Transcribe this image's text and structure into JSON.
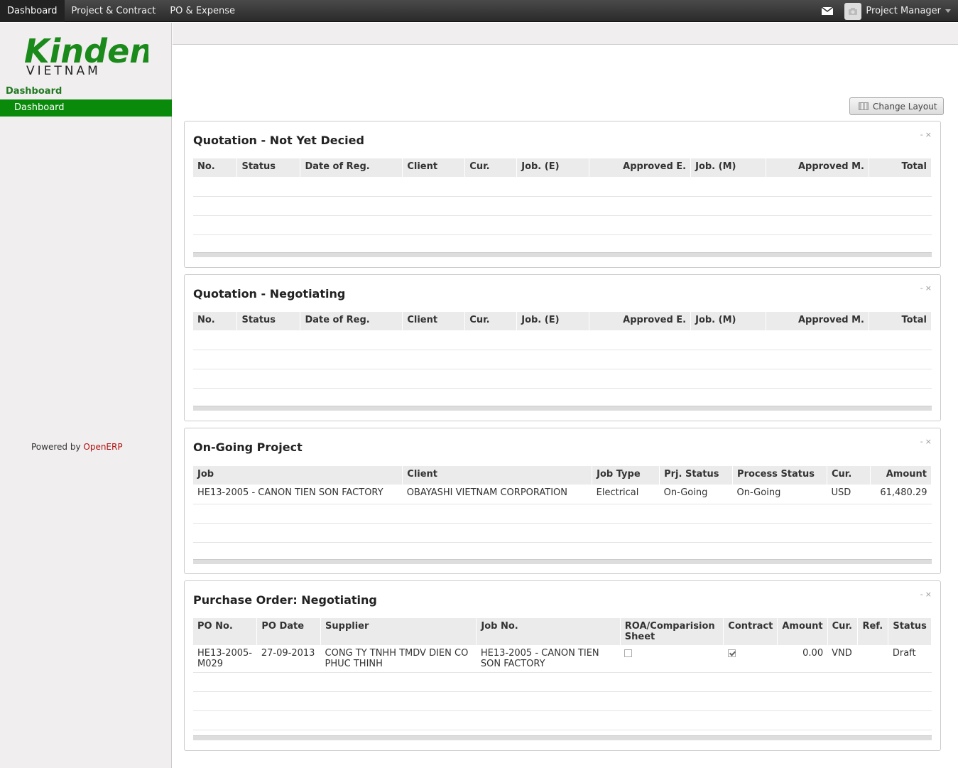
{
  "topnav": {
    "items": [
      "Dashboard",
      "Project & Contract",
      "PO & Expense"
    ],
    "user": "Project Manager"
  },
  "sidebar": {
    "logo_top": "Kinden",
    "logo_bottom": "VIETNAM",
    "section_title": "Dashboard",
    "item": "Dashboard",
    "powered_prefix": "Powered by ",
    "powered_link": "OpenERP"
  },
  "layout_button": "Change Layout",
  "panel_controls": {
    "min": "-",
    "close": "×"
  },
  "quotation_cols": [
    "No.",
    "Status",
    "Date of Reg.",
    "Client",
    "Cur.",
    "Job. (E)",
    "Approved E.",
    "Job. (M)",
    "Approved M.",
    "Total"
  ],
  "panels": {
    "q1": {
      "title": "Quotation - Not Yet Decied"
    },
    "q2": {
      "title": "Quotation - Negotiating"
    },
    "ongoing": {
      "title": "On-Going Project",
      "cols": [
        "Job",
        "Client",
        "Job Type",
        "Prj. Status",
        "Process Status",
        "Cur.",
        "Amount"
      ],
      "rows": [
        {
          "job": "HE13-2005 - CANON TIEN SON FACTORY",
          "client": "OBAYASHI VIETNAM CORPORATION",
          "job_type": "Electrical",
          "prj_status": "On-Going",
          "process_status": "On-Going",
          "cur": "USD",
          "amount": "61,480.29"
        }
      ]
    },
    "po": {
      "title": "Purchase Order: Negotiating",
      "cols": [
        "PO No.",
        "PO Date",
        "Supplier",
        "Job No.",
        "ROA/Comparision Sheet",
        "Contract",
        "Amount",
        "Cur.",
        "Ref.",
        "Status"
      ],
      "rows": [
        {
          "po_no": "HE13-2005-M029",
          "po_date": "27-09-2013",
          "supplier": "CONG TY TNHH TMDV DIEN CO PHUC THINH",
          "job_no": "HE13-2005 - CANON TIEN SON FACTORY",
          "roa": false,
          "contract": true,
          "amount": "0.00",
          "cur": "VND",
          "ref": "",
          "status": "Draft"
        }
      ]
    }
  },
  "colors": {
    "green": "#0a8a0a",
    "logo_green": "#1a8a1a",
    "topbar": "#333333"
  },
  "icons": [
    "mail-icon",
    "avatar-icon",
    "caret-down-icon",
    "layout-icon",
    "minimize-icon",
    "close-icon",
    "checkbox-icon"
  ]
}
